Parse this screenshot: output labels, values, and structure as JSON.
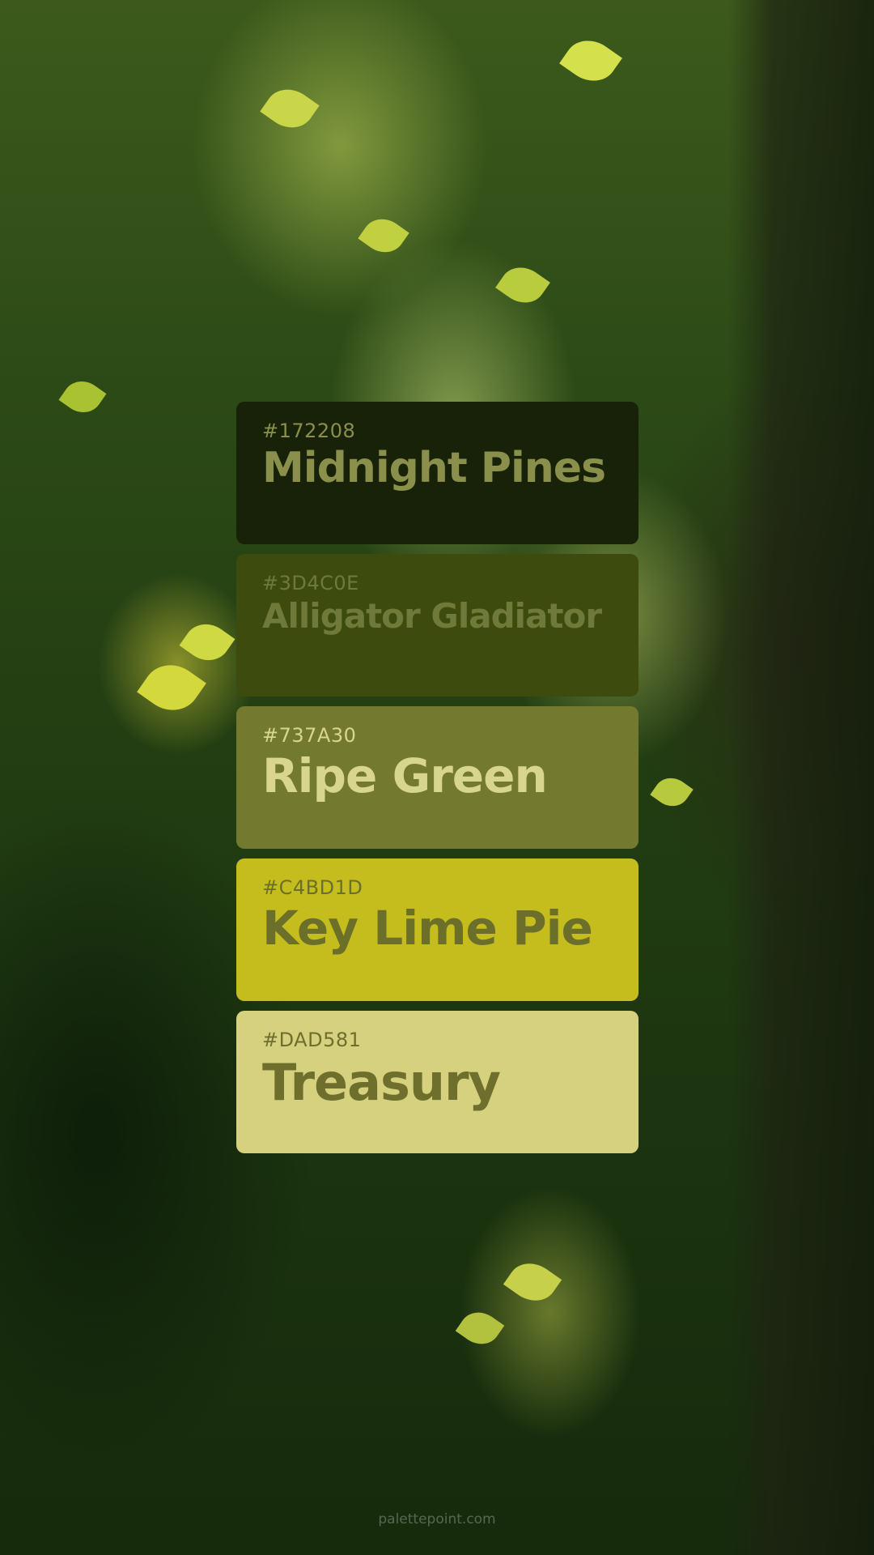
{
  "swatches": [
    {
      "hex": "#172208",
      "name": "Midnight Pines",
      "bg": "#172208",
      "fg": "#8a8f4c"
    },
    {
      "hex": "#3D4C0E",
      "name": "Alligator Gladiator",
      "bg": "#3D4C0E",
      "fg": "#6f7a3a"
    },
    {
      "hex": "#737A30",
      "name": "Ripe Green",
      "bg": "#737A30",
      "fg": "#d8d68e"
    },
    {
      "hex": "#C4BD1D",
      "name": "Key Lime Pie",
      "bg": "#C4BD1D",
      "fg": "#6c6f2a"
    },
    {
      "hex": "#DAD581",
      "name": "Treasury",
      "bg": "#D6D17E",
      "fg": "#6e6f2c"
    }
  ],
  "watermark": "palettepoint.com"
}
